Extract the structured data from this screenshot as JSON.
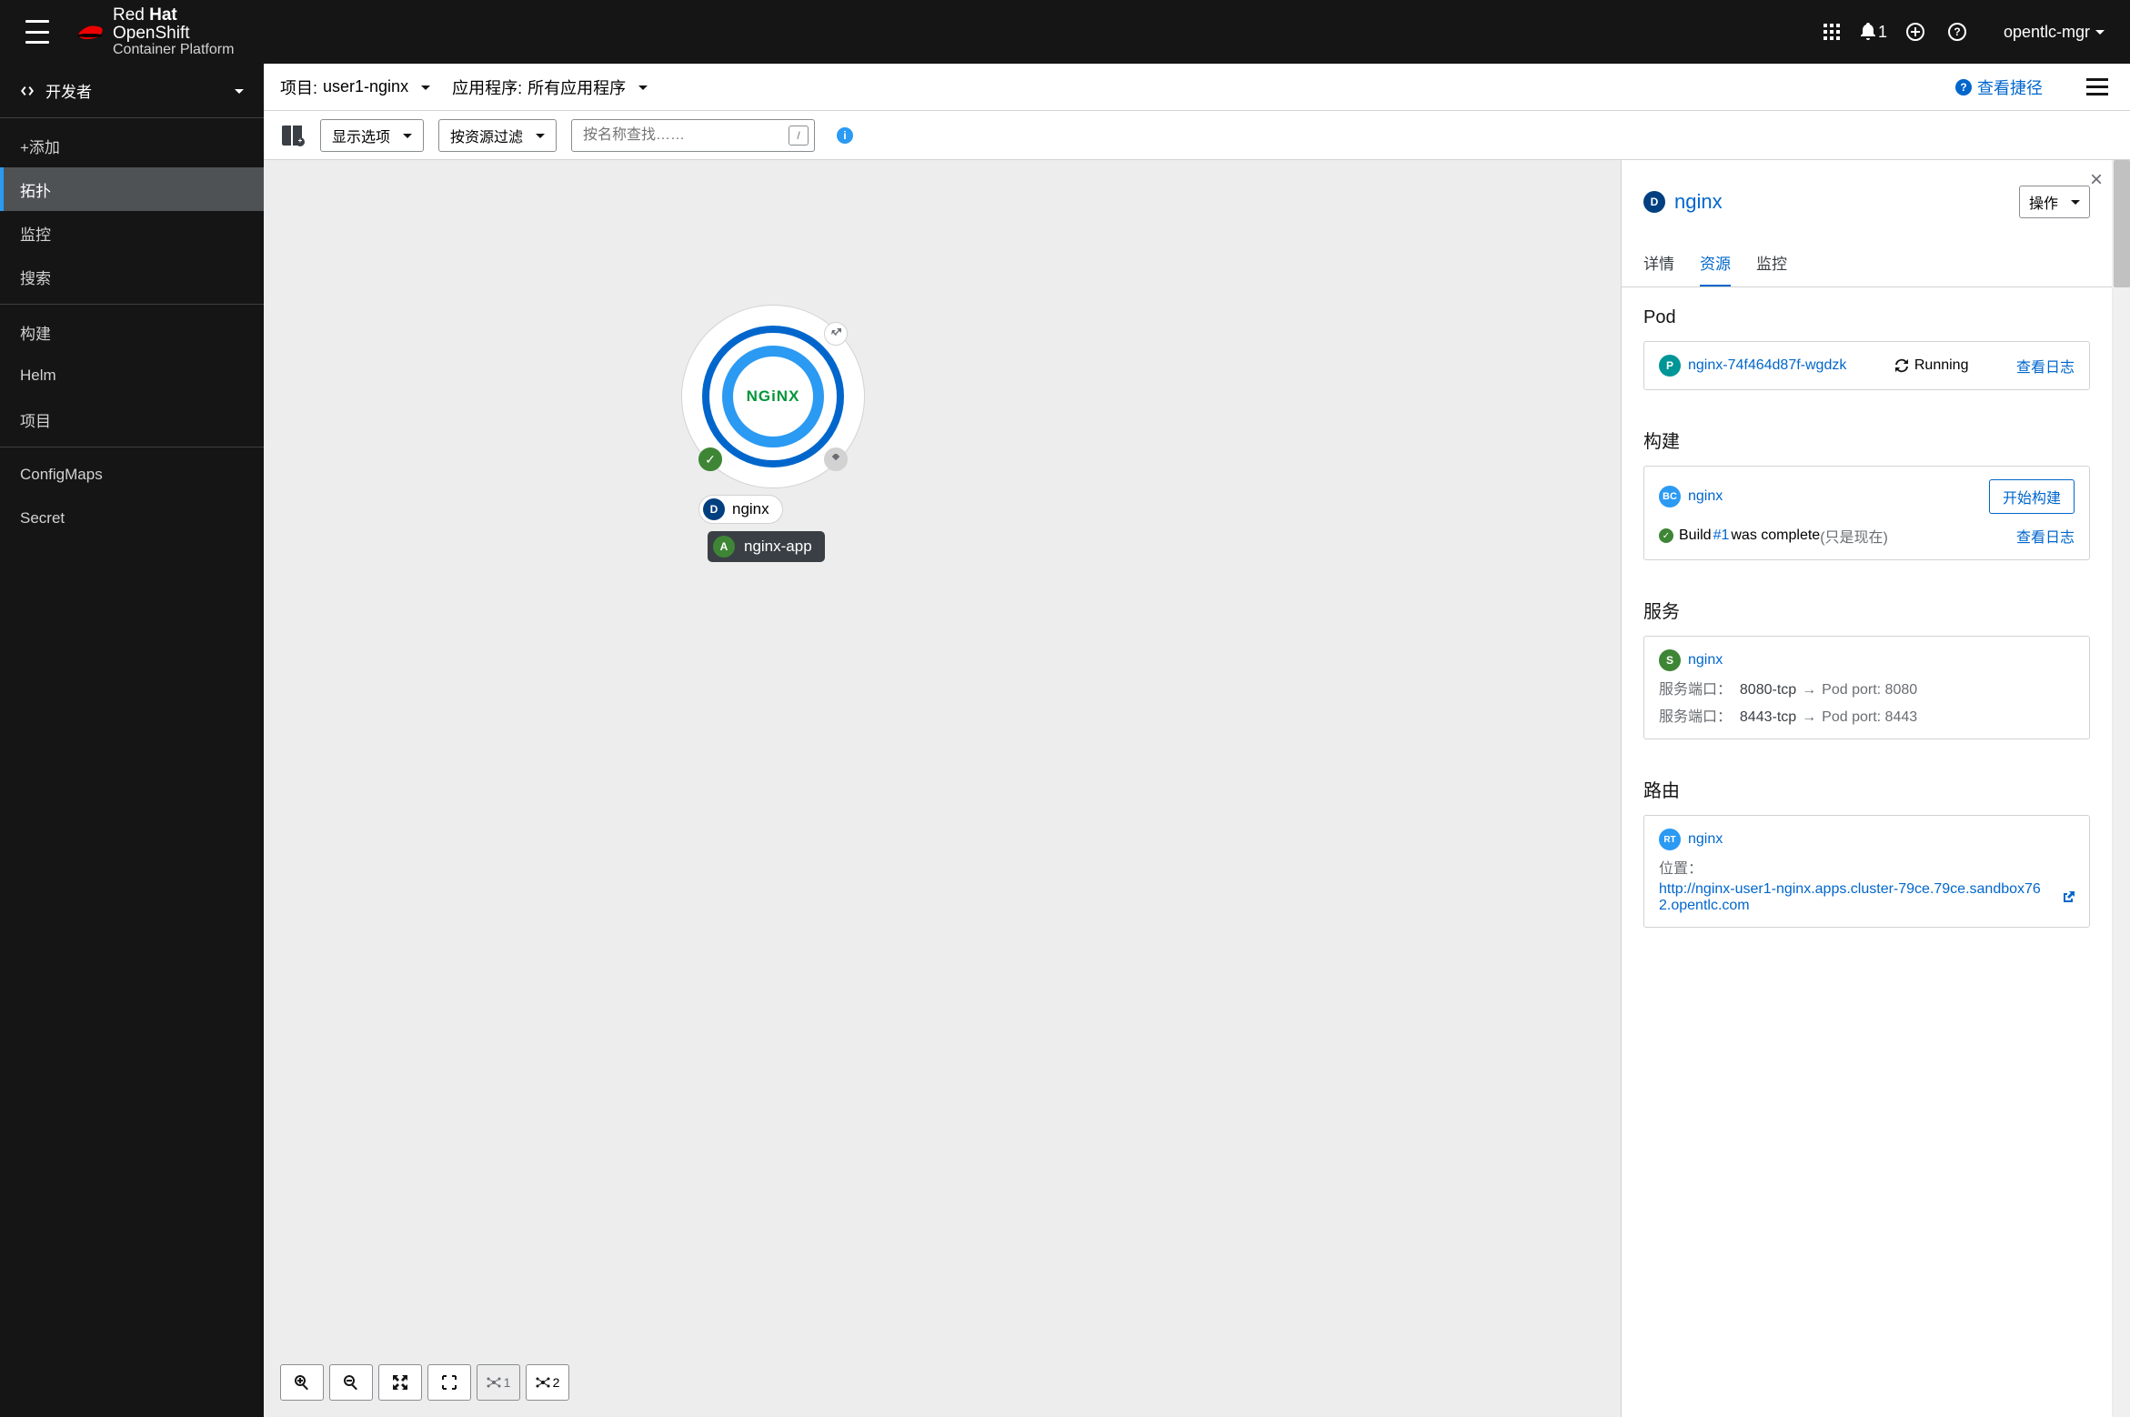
{
  "top": {
    "brand_redhat_1": "Red",
    "brand_redhat_2": "Hat",
    "brand_os": "OpenShift",
    "brand_cp": "Container Platform",
    "bell_count": "1",
    "user": "opentlc-mgr"
  },
  "perspective": {
    "label": "开发者"
  },
  "nav": {
    "add": "+添加",
    "topology": "拓扑",
    "monitoring": "监控",
    "search": "搜索",
    "build": "构建",
    "helm": "Helm",
    "project": "项目",
    "configmaps": "ConfigMaps",
    "secret": "Secret"
  },
  "pbar": {
    "project_label": "项目:",
    "project_value": "user1-nginx",
    "app_label": "应用程序:",
    "app_value": "所有应用程序",
    "shortcut": "查看捷径"
  },
  "toolbar": {
    "display": "显示选项",
    "filter": "按资源过滤",
    "search_placeholder": "按名称查找……"
  },
  "topo": {
    "node_name": "nginx",
    "node_logo": "NGiNX",
    "app_name": "nginx-app"
  },
  "zoombar": {
    "c1": "1",
    "c2": "2"
  },
  "panel": {
    "title": "nginx",
    "actions": "操作",
    "tabs": {
      "details": "详情",
      "resources": "资源",
      "monitoring": "监控"
    },
    "pod": {
      "heading": "Pod",
      "name": "nginx-74f464d87f-wgdzk",
      "status": "Running",
      "logs": "查看日志"
    },
    "build": {
      "heading": "构建",
      "name": "nginx",
      "start": "开始构建",
      "text1": "Build ",
      "text_num": "#1",
      "text2": " was complete ",
      "text3": "(只是现在)",
      "logs": "查看日志"
    },
    "service": {
      "heading": "服务",
      "name": "nginx",
      "row": [
        {
          "label": "服务端口：",
          "svc": "8080-tcp",
          "podlabel": "Pod port: ",
          "port": "8080"
        },
        {
          "label": "服务端口：",
          "svc": "8443-tcp",
          "podlabel": "Pod port: ",
          "port": "8443"
        }
      ]
    },
    "route": {
      "heading": "路由",
      "name": "nginx",
      "loc_label": "位置：",
      "url": "http://nginx-user1-nginx.apps.cluster-79ce.79ce.sandbox762.opentlc.com"
    }
  }
}
